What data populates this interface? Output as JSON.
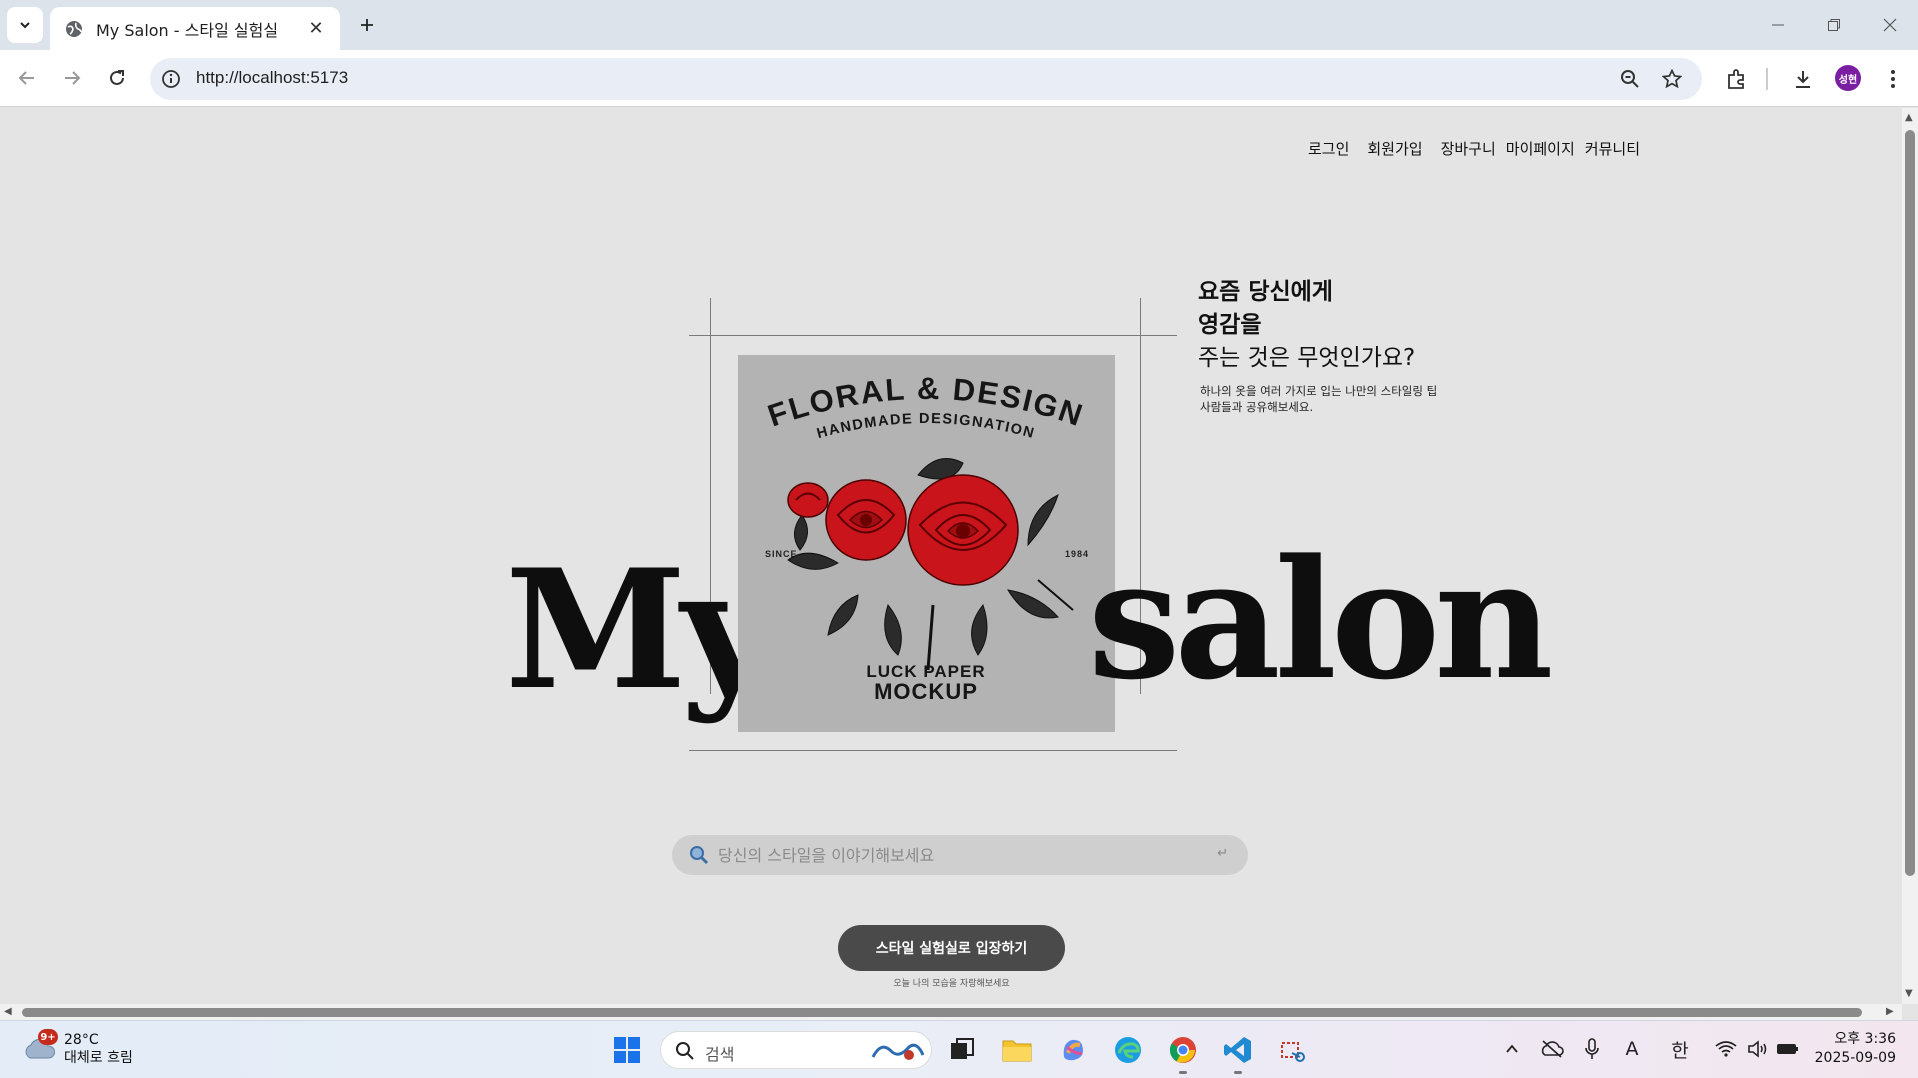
{
  "browser": {
    "tab_title": "My Salon - 스타일 실험실",
    "url": "http://localhost:5173",
    "profile_initials": "성현"
  },
  "nav": {
    "items": [
      "로그인",
      "회원가입",
      "장바구니",
      "마이페이지",
      "커뮤니티"
    ]
  },
  "hero": {
    "big_left": "My",
    "big_right": "salon",
    "headline_bold_1": "요즘 당신에게",
    "headline_bold_2": "영감을",
    "headline_regular": "주는 것은 무엇인가요?",
    "sub_1": "하나의 옷을 여러 가지로 입는 나만의 스타일링 팁",
    "sub_2": "사람들과 공유해보세요."
  },
  "poster": {
    "title": "FLORAL & DESIGN",
    "subtitle": "HANDMADE DESIGNATION",
    "since": "SINCE",
    "year": "1984",
    "footer_1": "LUCK PAPER",
    "footer_2": "MOCKUP"
  },
  "search": {
    "placeholder": "당신의 스타일을 이야기해보세요",
    "enter_glyph": "↵"
  },
  "cta": {
    "button_label": "스타일 실험실로 입장하기",
    "caption": "오늘 나의 모습을 자랑해보세요"
  },
  "taskbar": {
    "weather_badge": "9+",
    "weather_temp": "28°C",
    "weather_desc": "대체로 흐림",
    "search_label": "검색",
    "ime_a": "A",
    "ime_lang": "한",
    "clock_time": "오후 3:36",
    "clock_date": "2025-09-09"
  },
  "colors": {
    "page_bg": "#e4e4e4",
    "poster_bg": "#b3b3b3",
    "rose_red": "#c8141a",
    "cta_bg": "#4a4a4a"
  }
}
